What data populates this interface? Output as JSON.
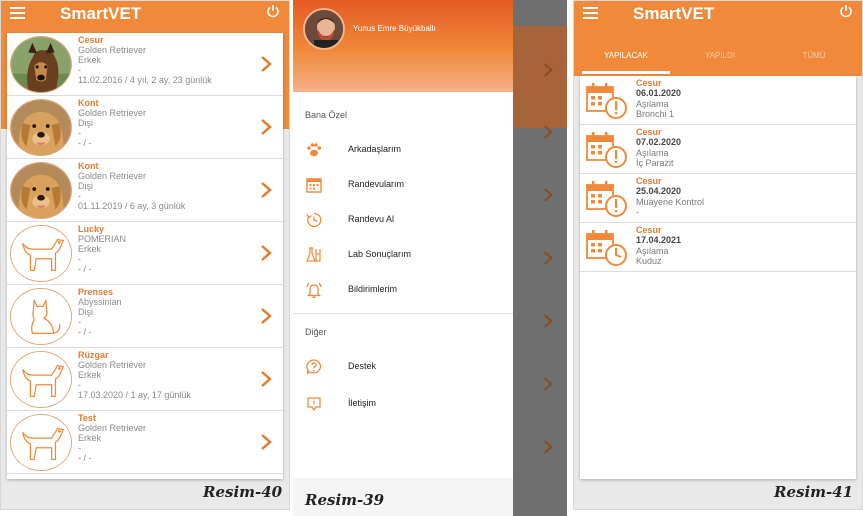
{
  "colors": {
    "primary": "#f08a3a",
    "accent_text": "#e57a2c"
  },
  "left_screen": {
    "title": "SmartVET",
    "pets": [
      {
        "name": "Cesur",
        "breed": "Golden Retriever",
        "gender": "Erkek",
        "extra": "-",
        "birth": "11.02.2016 / 4 yıl, 2 ay, 23 günlük",
        "avatar": "dog-photo"
      },
      {
        "name": "Kont",
        "breed": "Golden Retriever",
        "gender": "Dişi",
        "extra": "-",
        "birth": "- / -",
        "avatar": "golden-photo"
      },
      {
        "name": "Kont",
        "breed": "Golden Retriever",
        "gender": "Dişi",
        "extra": "-",
        "birth": "01.11.2019 / 6 ay, 3 günlük",
        "avatar": "golden-photo"
      },
      {
        "name": "Lucky",
        "breed": "POMERIAN",
        "gender": "Erkek",
        "extra": "-",
        "birth": "- / -",
        "avatar": "dog-icon"
      },
      {
        "name": "Prenses",
        "breed": "Abyssinian",
        "gender": "Dişi",
        "extra": "-",
        "birth": "- / -",
        "avatar": "cat-icon"
      },
      {
        "name": "Rüzgar",
        "breed": "Golden Retriever",
        "gender": "Erkek",
        "extra": "-",
        "birth": "17.03.2020 / 1 ay, 17 günlük",
        "avatar": "dog-icon"
      },
      {
        "name": "Test",
        "breed": "Golden Retriever",
        "gender": "Erkek",
        "extra": "-",
        "birth": "- / -",
        "avatar": "dog-icon"
      }
    ],
    "caption": "Resim-40"
  },
  "middle_screen": {
    "user_name": "Yunus Emre Büyükballı",
    "section_personal": "Bana Özel",
    "menu_personal": [
      {
        "label": "Arkadaşlarım",
        "icon": "paw-icon"
      },
      {
        "label": "Randevularım",
        "icon": "calendar-icon"
      },
      {
        "label": "Randevu Al",
        "icon": "clock-icon"
      },
      {
        "label": "Lab Sonuçlarım",
        "icon": "lab-icon"
      },
      {
        "label": "Bildirimlerim",
        "icon": "bell-icon"
      }
    ],
    "section_other": "Diğer",
    "menu_other": [
      {
        "label": "Destek",
        "icon": "help-icon"
      },
      {
        "label": "İletişim",
        "icon": "contact-icon"
      }
    ],
    "caption": "Resim-39"
  },
  "right_screen": {
    "title": "SmartVET",
    "tabs": [
      {
        "label": "YAPILACAK",
        "active": true
      },
      {
        "label": "YAPILDI",
        "active": false
      },
      {
        "label": "TÜMÜ",
        "active": false
      }
    ],
    "appointments": [
      {
        "pet": "Cesur",
        "date": "06.01.2020",
        "type": "Aşılama",
        "detail": "Bronchi 1",
        "icon": "calendar-alert-icon"
      },
      {
        "pet": "Cesur",
        "date": "07.02.2020",
        "type": "Aşılama",
        "detail": "İç Parazit",
        "icon": "calendar-alert-icon"
      },
      {
        "pet": "Cesur",
        "date": "25.04.2020",
        "type": "Muayene Kontrol",
        "detail": "-",
        "icon": "calendar-alert-icon"
      },
      {
        "pet": "Cesur",
        "date": "17.04.2021",
        "type": "Aşılama",
        "detail": "Kuduz",
        "icon": "calendar-clock-icon"
      }
    ],
    "caption": "Resim-41"
  }
}
